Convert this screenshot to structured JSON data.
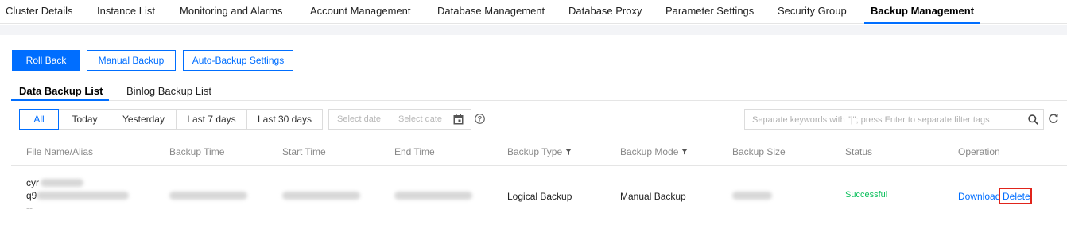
{
  "nav": {
    "tabs": [
      "Cluster Details",
      "Instance List",
      "Monitoring and Alarms",
      "Account Management",
      "Database Management",
      "Database Proxy",
      "Parameter Settings",
      "Security Group",
      "Backup Management"
    ],
    "active": "Backup Management"
  },
  "actions": {
    "rollback": "Roll Back",
    "manual_backup": "Manual Backup",
    "auto_backup_settings": "Auto-Backup Settings"
  },
  "subtabs": {
    "data_backup": "Data Backup List",
    "binlog_backup": "Binlog Backup List",
    "active": "Data Backup List"
  },
  "filters": {
    "ranges": [
      "All",
      "Today",
      "Yesterday",
      "Last 7 days",
      "Last 30 days"
    ],
    "active": "All",
    "start_date_placeholder": "Select date",
    "end_date_placeholder": "Select date",
    "search_placeholder": "Separate keywords with \"|\"; press Enter to separate filter tags"
  },
  "table": {
    "columns": [
      "File Name/Alias",
      "Backup Time",
      "Start Time",
      "End Time",
      "Backup Type",
      "Backup Mode",
      "Backup Size",
      "Status",
      "Operation"
    ],
    "filterable_columns": [
      "Backup Type",
      "Backup Mode"
    ],
    "rows": [
      {
        "file_name_line1": "cyr",
        "file_name_line2": "q9",
        "file_name_line3": "--",
        "backup_type": "Logical Backup",
        "backup_mode": "Manual Backup",
        "status": "Successful",
        "operations": [
          "Download",
          "Delete"
        ]
      }
    ]
  },
  "colors": {
    "accent": "#006eff",
    "success": "#0abf5b",
    "highlight": "#e0241b"
  }
}
